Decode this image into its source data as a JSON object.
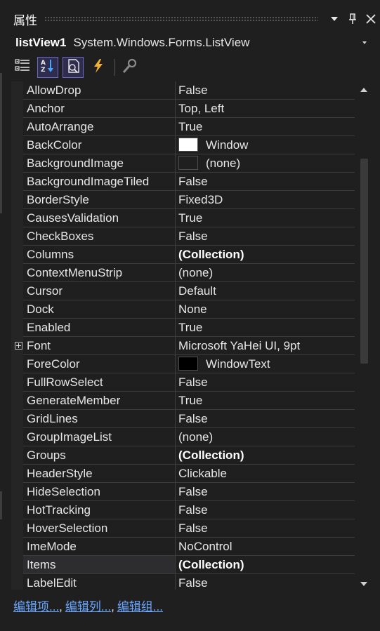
{
  "window": {
    "title": "属性",
    "buttons": {
      "dropdown": "chevron-down",
      "pin": "pin",
      "close": "close"
    }
  },
  "object_selector": {
    "name": "listView1",
    "type": "System.Windows.Forms.ListView"
  },
  "toolbar": {
    "tools": [
      {
        "icon": "categorized-icon",
        "active": false
      },
      {
        "icon": "alphabetical-icon",
        "active": true
      },
      {
        "icon": "properties-icon",
        "active": true
      },
      {
        "icon": "events-lightning-icon",
        "active": false
      },
      {
        "icon": "property-pages-wrench-icon",
        "active": false
      }
    ]
  },
  "properties": [
    {
      "name": "AllowDrop",
      "value": "False"
    },
    {
      "name": "Anchor",
      "value": "Top, Left"
    },
    {
      "name": "AutoArrange",
      "value": "True"
    },
    {
      "name": "BackColor",
      "value": "Window",
      "swatch": "#ffffff"
    },
    {
      "name": "BackgroundImage",
      "value": "(none)",
      "swatch": "#1f1f1f"
    },
    {
      "name": "BackgroundImageTiled",
      "value": "False"
    },
    {
      "name": "BorderStyle",
      "value": "Fixed3D"
    },
    {
      "name": "CausesValidation",
      "value": "True"
    },
    {
      "name": "CheckBoxes",
      "value": "False"
    },
    {
      "name": "Columns",
      "value": "(Collection)",
      "bold": true
    },
    {
      "name": "ContextMenuStrip",
      "value": "(none)"
    },
    {
      "name": "Cursor",
      "value": "Default"
    },
    {
      "name": "Dock",
      "value": "None"
    },
    {
      "name": "Enabled",
      "value": "True"
    },
    {
      "name": "Font",
      "value": "Microsoft YaHei UI, 9pt",
      "expandable": true
    },
    {
      "name": "ForeColor",
      "value": "WindowText",
      "swatch": "#000000"
    },
    {
      "name": "FullRowSelect",
      "value": "False"
    },
    {
      "name": "GenerateMember",
      "value": "True"
    },
    {
      "name": "GridLines",
      "value": "False"
    },
    {
      "name": "GroupImageList",
      "value": "(none)"
    },
    {
      "name": "Groups",
      "value": "(Collection)",
      "bold": true
    },
    {
      "name": "HeaderStyle",
      "value": "Clickable"
    },
    {
      "name": "HideSelection",
      "value": "False"
    },
    {
      "name": "HotTracking",
      "value": "False"
    },
    {
      "name": "HoverSelection",
      "value": "False"
    },
    {
      "name": "ImeMode",
      "value": "NoControl"
    },
    {
      "name": "Items",
      "value": "(Collection)",
      "bold": true,
      "selected": true
    },
    {
      "name": "LabelEdit",
      "value": "False"
    }
  ],
  "commands": {
    "edit_items": "编辑项...",
    "edit_columns": "编辑列...",
    "edit_groups": "编辑组...",
    "separator": ","
  },
  "colors": {
    "background": "#1f1f1f",
    "link": "#6aa7ff",
    "accent": "#6d69c9"
  }
}
